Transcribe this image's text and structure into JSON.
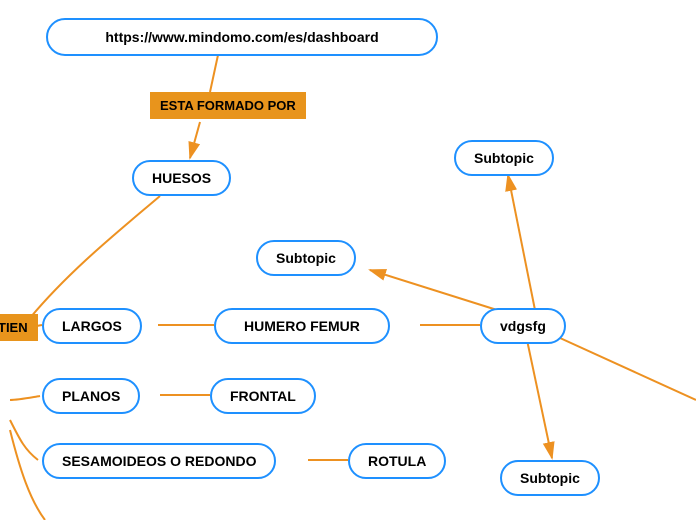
{
  "root": {
    "text": "https://www.mindomo.com/es/dashboard"
  },
  "edge_labels": {
    "esta_formado_por": "ESTA FORMADO POR",
    "tien": "TIEN"
  },
  "nodes": {
    "huesos": "HUESOS",
    "subtopic_top": "Subtopic",
    "subtopic_mid": "Subtopic",
    "largos": "LARGOS",
    "humero_femur": "HUMERO FEMUR",
    "vdgsfg": "vdgsfg",
    "planos": "PLANOS",
    "frontal": "FRONTAL",
    "sesamoideos": "SESAMOIDEOS O REDONDO",
    "rotula": "ROTULA",
    "subtopic_bottom": "Subtopic"
  },
  "colors": {
    "node_border": "#1e90ff",
    "label_bg": "#e8941c",
    "connector": "#ed9121"
  }
}
